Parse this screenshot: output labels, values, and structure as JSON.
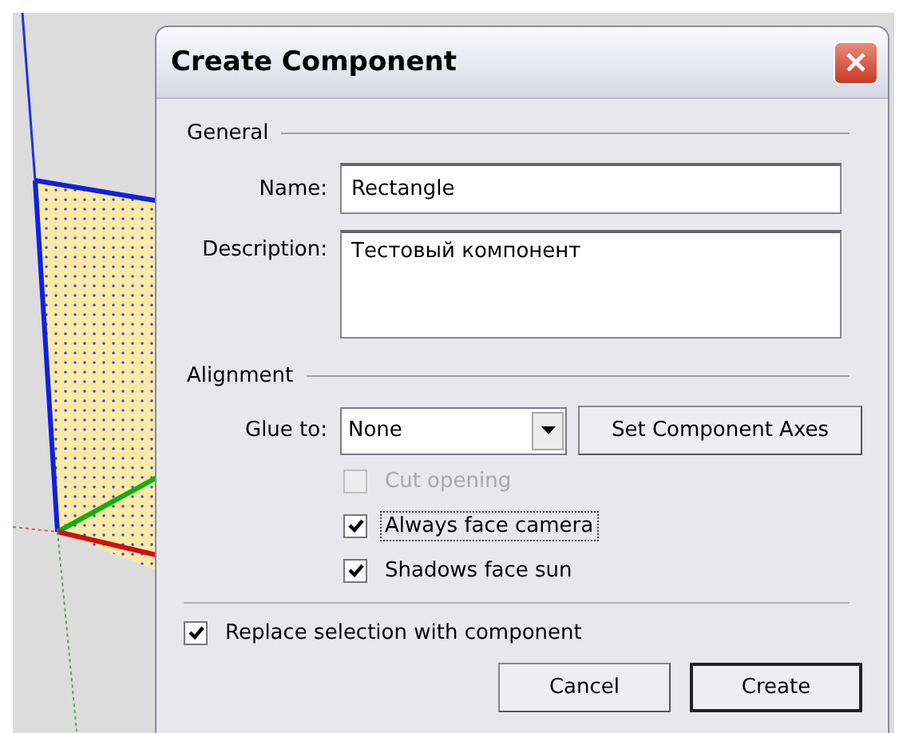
{
  "window": {
    "title": "Create Component"
  },
  "general": {
    "heading": "General",
    "name_label": "Name:",
    "name_value": "Rectangle",
    "description_label": "Description:",
    "description_value": "Тестовый компонент"
  },
  "alignment": {
    "heading": "Alignment",
    "glue_label": "Glue to:",
    "glue_value": "None",
    "axes_button": "Set Component Axes",
    "options": [
      {
        "label": "Cut opening",
        "checked": false,
        "disabled": true,
        "focused": false
      },
      {
        "label": "Always face camera",
        "checked": true,
        "disabled": false,
        "focused": true
      },
      {
        "label": "Shadows face sun",
        "checked": true,
        "disabled": false,
        "focused": false
      }
    ]
  },
  "replace": {
    "label": "Replace selection with component",
    "checked": true
  },
  "buttons": [
    {
      "label": "Cancel",
      "default": false
    },
    {
      "label": "Create",
      "default": true
    }
  ]
}
